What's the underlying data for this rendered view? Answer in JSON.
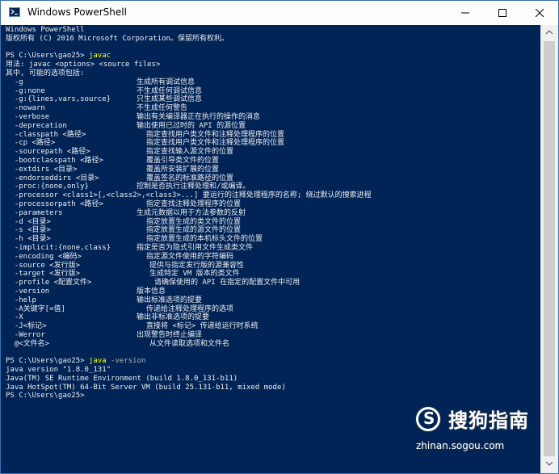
{
  "window": {
    "title": "Windows PowerShell"
  },
  "icons": {
    "app": "powershell-icon",
    "minimize": "minimize-icon",
    "maximize": "maximize-icon",
    "close": "close-icon"
  },
  "colors": {
    "console_bg": "#012456",
    "console_fg": "#eeedf0",
    "command": "#ffff00",
    "parameter": "#b0b0b0"
  },
  "console": {
    "lines": [
      {
        "a": "Windows PowerShell",
        "col": "",
        "b": ""
      },
      {
        "a": "版权所有 (C) 2016 Microsoft Corporation。保留所有权利。",
        "col": "",
        "b": ""
      },
      {
        "a": "",
        "col": "",
        "b": ""
      },
      {
        "a": "PS C:\\Users\\gao25> ",
        "cmd": "javac",
        "col": "",
        "b": ""
      },
      {
        "a": "用法: javac <options> <source files>",
        "col": "",
        "b": ""
      },
      {
        "a": "其中, 可能的选项包括:",
        "col": "",
        "b": ""
      },
      {
        "a": "  -g",
        "col": "c162",
        "b": "生成所有调试信息"
      },
      {
        "a": "  -g:none",
        "col": "c162",
        "b": "不生成任何调试信息"
      },
      {
        "a": "  -g:{lines,vars,source}",
        "col": "c162",
        "b": "只生成某些调试信息"
      },
      {
        "a": "  -nowarn",
        "col": "c162",
        "b": "不生成任何警告"
      },
      {
        "a": "  -verbose",
        "col": "c162",
        "b": "输出有关编译器正在执行的操作的消息"
      },
      {
        "a": "  -deprecation",
        "col": "c162",
        "b": "输出使用已过时的 API 的源位置"
      },
      {
        "a": "  -classpath <路径>",
        "col": "c174",
        "b": "指定查找用户类文件和注释处理程序的位置"
      },
      {
        "a": "  -cp <路径>",
        "col": "c174",
        "b": "指定查找用户类文件和注释处理程序的位置"
      },
      {
        "a": "  -sourcepath <路径>",
        "col": "c174",
        "b": "指定查找输入源文件的位置"
      },
      {
        "a": "  -bootclasspath <路径>",
        "col": "c174",
        "b": "覆盖引导类文件的位置"
      },
      {
        "a": "  -extdirs <目录>",
        "col": "c174",
        "b": "覆盖所安装扩展的位置"
      },
      {
        "a": "  -endorseddirs <目录>",
        "col": "c174",
        "b": "覆盖签名的标准路径的位置"
      },
      {
        "a": "  -proc:{none,only}",
        "col": "c162",
        "b": "控制是否执行注释处理和/或编译。"
      },
      {
        "a": "  -processor <class1>[,<class2>,<class3>...] 要运行的注释处理程序的名称; 绕过默认的搜索进程",
        "col": "",
        "b": ""
      },
      {
        "a": "  -processorpath <路径>",
        "col": "c174",
        "b": "指定查找注释处理程序的位置"
      },
      {
        "a": "  -parameters",
        "col": "c162",
        "b": "生成元数据以用于方法参数的反射"
      },
      {
        "a": "  -d <目录>",
        "col": "c174",
        "b": "指定放置生成的类文件的位置"
      },
      {
        "a": "  -s <目录>",
        "col": "c174",
        "b": "指定放置生成的源文件的位置"
      },
      {
        "a": "  -h <目录>",
        "col": "c174",
        "b": "指定放置生成的本机标头文件的位置"
      },
      {
        "a": "  -implicit:{none,class}",
        "col": "c162",
        "b": "指定是否为隐式引用文件生成类文件"
      },
      {
        "a": "  -encoding <编码>",
        "col": "c174",
        "b": "指定源文件使用的字符编码"
      },
      {
        "a": "  -source <发行版>",
        "col": "c178",
        "b": "提供与指定发行版的源兼容性"
      },
      {
        "a": "  -target <发行版>",
        "col": "c178",
        "b": "生成特定 VM 版本的类文件"
      },
      {
        "a": "  -profile <配置文件>",
        "col": "c184",
        "b": "请确保使用的 API 在指定的配置文件中可用"
      },
      {
        "a": "  -version",
        "col": "c162",
        "b": "版本信息"
      },
      {
        "a": "  -help",
        "col": "c162",
        "b": "输出标准选项的提要"
      },
      {
        "a": "  -A关键字[=值]",
        "col": "c174",
        "b": "传递给注释处理程序的选项"
      },
      {
        "a": "  -X",
        "col": "c162",
        "b": "输出非标准选项的提要"
      },
      {
        "a": "  -J<标记>",
        "col": "c174",
        "b": "直接将 <标记> 传递给运行时系统"
      },
      {
        "a": "  -Werror",
        "col": "c162",
        "b": "出现警告时终止编译"
      },
      {
        "a": "  @<文件名>",
        "col": "c178",
        "b": "从文件读取选项和文件名"
      },
      {
        "a": "",
        "col": "",
        "b": ""
      },
      {
        "a": "PS C:\\Users\\gao25> ",
        "cmd": "java",
        "param": " -version",
        "col": "",
        "b": ""
      },
      {
        "a": "java version \"1.8.0_131\"",
        "col": "",
        "b": ""
      },
      {
        "a": "Java(TM) SE Runtime Environment (build 1.8.0_131-b11)",
        "col": "",
        "b": ""
      },
      {
        "a": "Java HotSpot(TM) 64-Bit Server VM (build 25.131-b11, mixed mode)",
        "col": "",
        "b": ""
      },
      {
        "a": "PS C:\\Users\\gao25>",
        "col": "",
        "b": ""
      }
    ]
  },
  "watermark": {
    "logo_text": "搜狗指南",
    "url": "zhinan.sogou.com"
  }
}
